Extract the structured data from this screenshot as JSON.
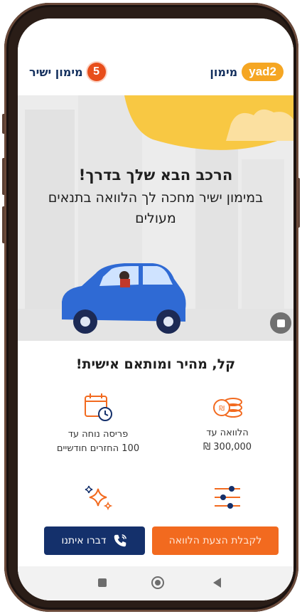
{
  "header": {
    "left_brand": "מימון ישיר",
    "left_badge": "5",
    "right_brand_pill": "yad2",
    "right_brand_text": "מימון"
  },
  "hero": {
    "title": "הרכב הבא שלך בדרך!",
    "subtitle": "במימון ישיר מחכה לך הלוואה בתנאים מעולים"
  },
  "section": {
    "title": "קל, מהיר ומותאם אישית!"
  },
  "features": [
    {
      "icon": "coins-icon",
      "line1": "הלוואה עד",
      "line2": "300,000 ₪"
    },
    {
      "icon": "calendar-clock-icon",
      "line1": "פריסה נוחה עד",
      "line2": "100 החזרים חודשיים"
    },
    {
      "icon": "sliders-icon"
    },
    {
      "icon": "sparkles-icon"
    }
  ],
  "cta": {
    "primary_label": "לקבלת הצעת הלוואה",
    "secondary_label": "דברו איתנו"
  },
  "colors": {
    "orange": "#f26a1f",
    "navy": "#14306b",
    "yad2_yellow": "#f5a623",
    "sun_yellow": "#f8c843",
    "car_blue": "#2f6ad4"
  }
}
